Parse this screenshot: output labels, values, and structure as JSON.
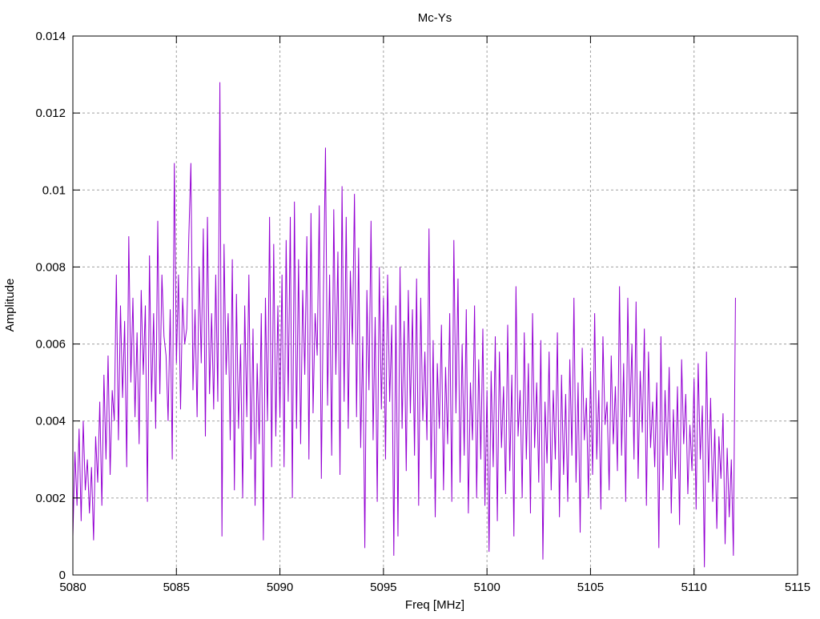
{
  "chart_data": {
    "type": "line",
    "title": "Mc-Ys",
    "xlabel": "Freq [MHz]",
    "ylabel": "Amplitude",
    "xlim": [
      5080,
      5115
    ],
    "ylim": [
      0,
      0.014
    ],
    "xticks": [
      5080,
      5085,
      5090,
      5095,
      5100,
      5105,
      5110,
      5115
    ],
    "xtick_labels": [
      "5080",
      "5085",
      "5090",
      "5095",
      "5100",
      "5105",
      "5110",
      "5115"
    ],
    "yticks": [
      0,
      0.002,
      0.004,
      0.006,
      0.008,
      0.01,
      0.012,
      0.014
    ],
    "ytick_labels": [
      "0",
      "0.002",
      "0.004",
      "0.006",
      "0.008",
      "0.01",
      "0.012",
      "0.014"
    ],
    "grid": true,
    "series": [
      {
        "name": "Mc-Ys",
        "color": "#9400d3",
        "x_start": 5080,
        "x_step": 0.1,
        "values": [
          0.001,
          0.0032,
          0.0018,
          0.0038,
          0.0014,
          0.004,
          0.0022,
          0.003,
          0.0016,
          0.0028,
          0.0009,
          0.0036,
          0.0024,
          0.0045,
          0.0018,
          0.0052,
          0.003,
          0.0057,
          0.0026,
          0.0048,
          0.004,
          0.0078,
          0.0035,
          0.007,
          0.0046,
          0.0066,
          0.0028,
          0.0088,
          0.005,
          0.0072,
          0.0041,
          0.0063,
          0.0034,
          0.0074,
          0.0052,
          0.007,
          0.0019,
          0.0083,
          0.0045,
          0.0068,
          0.0038,
          0.0092,
          0.0047,
          0.0078,
          0.0062,
          0.0057,
          0.004,
          0.0069,
          0.003,
          0.0107,
          0.0055,
          0.0078,
          0.0043,
          0.0072,
          0.006,
          0.0064,
          0.0088,
          0.0107,
          0.0048,
          0.0069,
          0.0041,
          0.008,
          0.0055,
          0.009,
          0.0036,
          0.0093,
          0.0047,
          0.0068,
          0.0043,
          0.0078,
          0.0045,
          0.0128,
          0.001,
          0.0086,
          0.0052,
          0.0068,
          0.0035,
          0.0082,
          0.0022,
          0.0073,
          0.0038,
          0.006,
          0.002,
          0.007,
          0.0041,
          0.0078,
          0.003,
          0.0064,
          0.0018,
          0.0055,
          0.0034,
          0.0068,
          0.0009,
          0.0072,
          0.004,
          0.0093,
          0.0028,
          0.0086,
          0.0036,
          0.007,
          0.0041,
          0.0078,
          0.0028,
          0.0087,
          0.0045,
          0.0093,
          0.002,
          0.0097,
          0.0038,
          0.0082,
          0.0034,
          0.0074,
          0.0052,
          0.0088,
          0.003,
          0.0094,
          0.0042,
          0.0068,
          0.0057,
          0.0096,
          0.0025,
          0.0073,
          0.0111,
          0.0044,
          0.0078,
          0.0031,
          0.0095,
          0.0052,
          0.0084,
          0.0026,
          0.0101,
          0.0045,
          0.0093,
          0.0038,
          0.0079,
          0.006,
          0.0099,
          0.0041,
          0.0085,
          0.0033,
          0.0062,
          0.0007,
          0.0074,
          0.0048,
          0.0092,
          0.0035,
          0.0067,
          0.0019,
          0.008,
          0.0043,
          0.0072,
          0.003,
          0.0078,
          0.0045,
          0.0065,
          0.0005,
          0.007,
          0.001,
          0.008,
          0.0038,
          0.0066,
          0.0027,
          0.0074,
          0.0042,
          0.0069,
          0.0031,
          0.0077,
          0.0018,
          0.0072,
          0.004,
          0.0058,
          0.0035,
          0.009,
          0.0025,
          0.0061,
          0.0015,
          0.0055,
          0.0038,
          0.0065,
          0.0022,
          0.0054,
          0.0034,
          0.0068,
          0.0019,
          0.0087,
          0.0042,
          0.0077,
          0.0024,
          0.006,
          0.0031,
          0.0069,
          0.0016,
          0.005,
          0.0035,
          0.007,
          0.002,
          0.0056,
          0.003,
          0.0064,
          0.0018,
          0.0048,
          0.0006,
          0.0053,
          0.0028,
          0.0062,
          0.0014,
          0.0058,
          0.0033,
          0.0049,
          0.0021,
          0.0065,
          0.0027,
          0.0052,
          0.001,
          0.0075,
          0.0036,
          0.0048,
          0.002,
          0.0063,
          0.003,
          0.0055,
          0.0016,
          0.0068,
          0.0033,
          0.005,
          0.0024,
          0.0061,
          0.0004,
          0.0045,
          0.0029,
          0.0058,
          0.0022,
          0.0048,
          0.003,
          0.0063,
          0.0015,
          0.0052,
          0.0026,
          0.0047,
          0.0019,
          0.0056,
          0.0031,
          0.0072,
          0.0024,
          0.005,
          0.0011,
          0.0059,
          0.0035,
          0.0046,
          0.002,
          0.0053,
          0.0026,
          0.0068,
          0.003,
          0.0048,
          0.0017,
          0.0062,
          0.0039,
          0.0045,
          0.0022,
          0.0057,
          0.0034,
          0.0049,
          0.0027,
          0.0075,
          0.0031,
          0.0055,
          0.0019,
          0.0072,
          0.0041,
          0.006,
          0.003,
          0.0071,
          0.0025,
          0.0053,
          0.0037,
          0.0064,
          0.0018,
          0.0058,
          0.0033,
          0.0045,
          0.0028,
          0.005,
          0.0007,
          0.0062,
          0.0022,
          0.0048,
          0.0031,
          0.0054,
          0.0016,
          0.0043,
          0.0025,
          0.0049,
          0.0013,
          0.0056,
          0.0034,
          0.0047,
          0.0021,
          0.0039,
          0.0027,
          0.0051,
          0.0017,
          0.0055,
          0.003,
          0.0044,
          0.0002,
          0.0058,
          0.0024,
          0.0046,
          0.0019,
          0.0038,
          0.0012,
          0.0036,
          0.0025,
          0.0042,
          0.0008,
          0.0033,
          0.0015,
          0.003,
          0.0005,
          0.0072
        ]
      }
    ]
  }
}
